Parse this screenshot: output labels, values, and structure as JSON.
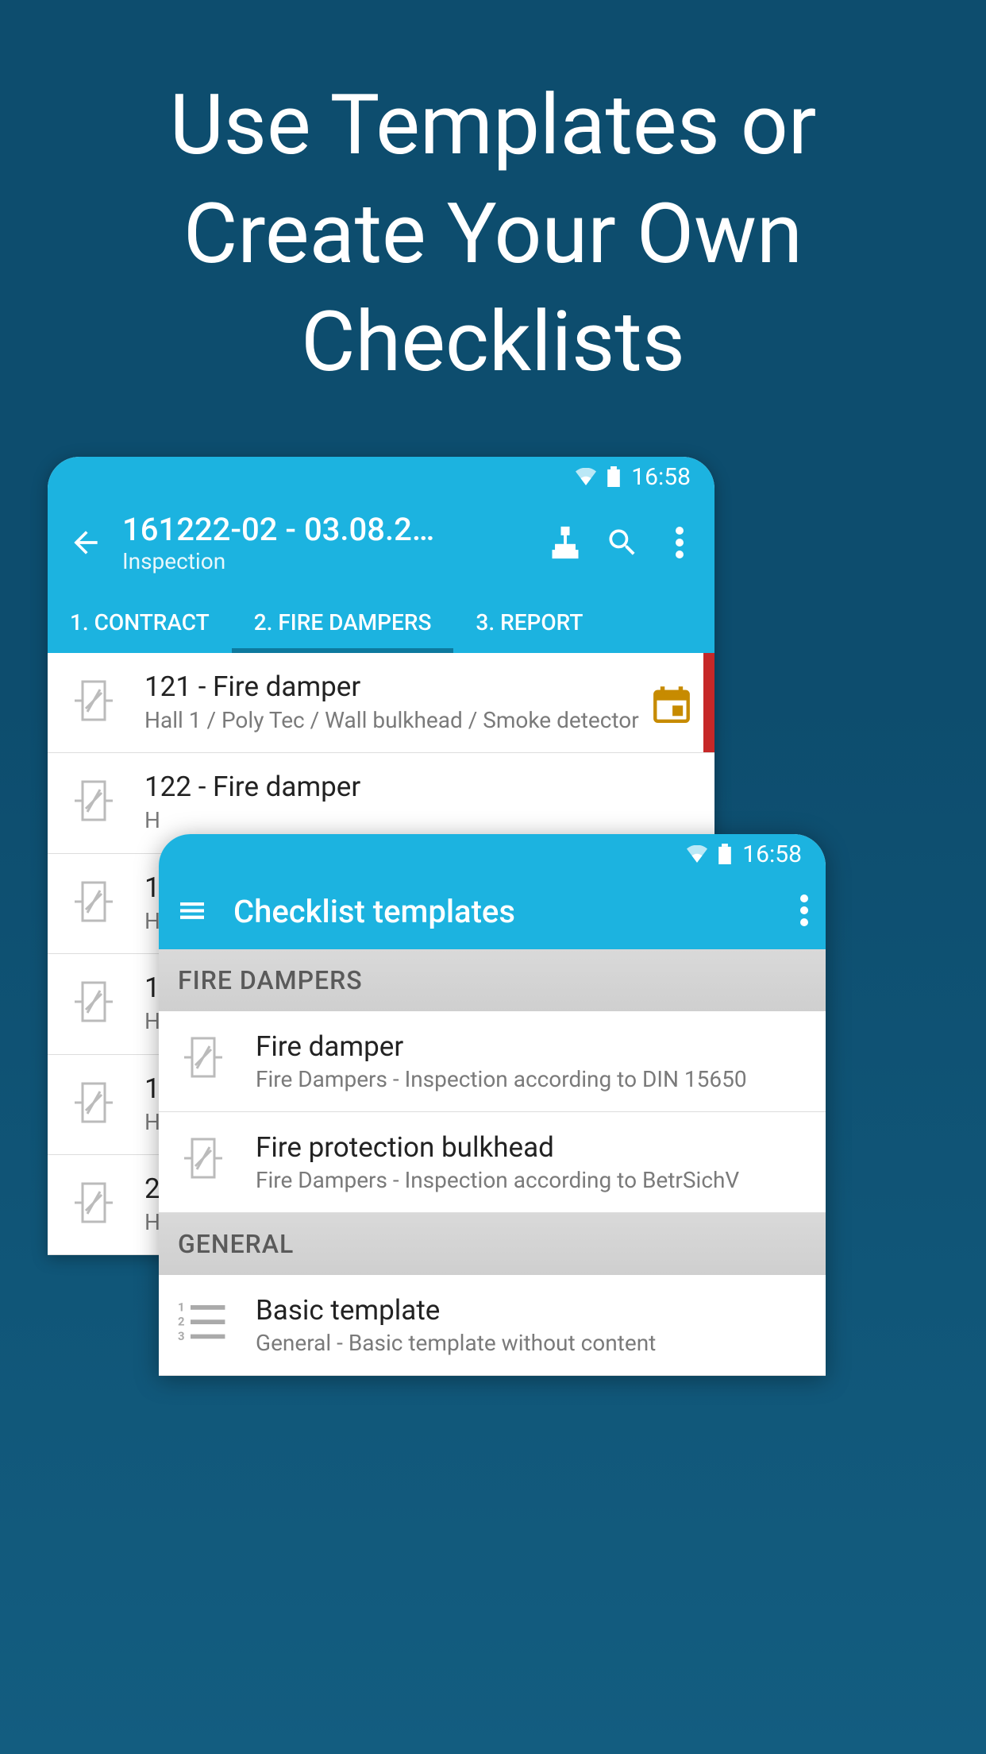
{
  "headline": "Use Templates or Create Your Own Checklists",
  "status": {
    "time": "16:58"
  },
  "phone1": {
    "title": "161222-02 - 03.08.2…",
    "subtitle": "Inspection",
    "tabs": [
      {
        "label": "1. CONTRACT"
      },
      {
        "label": "2. FIRE DAMPERS",
        "active": true
      },
      {
        "label": "3. REPORT"
      }
    ],
    "rows": [
      {
        "title": "121 - Fire damper",
        "sub": "Hall 1 / Poly Tec / Wall bulkhead / Smoke detector",
        "cal": true,
        "stripe": true
      },
      {
        "title": "122 - Fire damper",
        "sub": "H"
      },
      {
        "title": "1",
        "sub": "H\nT"
      },
      {
        "title": "1",
        "sub": "H\nT"
      },
      {
        "title": "1",
        "sub": "H"
      },
      {
        "title": "2",
        "sub": "H\nb"
      }
    ]
  },
  "phone2": {
    "title": "Checklist templates",
    "sections": [
      {
        "header": "FIRE DAMPERS",
        "items": [
          {
            "title": "Fire damper",
            "sub": "Fire Dampers - Inspection according to DIN 15650",
            "icon": "damper"
          },
          {
            "title": "Fire protection bulkhead",
            "sub": "Fire Dampers - Inspection according to BetrSichV",
            "icon": "damper"
          }
        ]
      },
      {
        "header": "GENERAL",
        "items": [
          {
            "title": "Basic template",
            "sub": "General - Basic template without content",
            "icon": "list"
          }
        ]
      }
    ]
  }
}
